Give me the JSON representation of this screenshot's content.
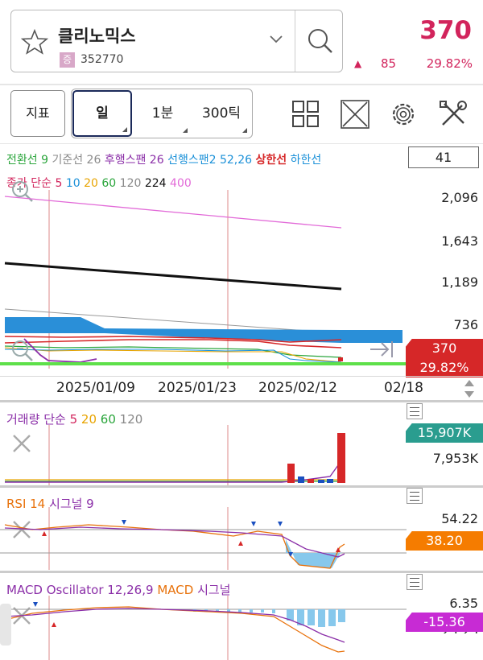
{
  "stock": {
    "name": "클리노믹스",
    "market_badge": "증",
    "code": "352770"
  },
  "quote": {
    "price": "370",
    "change_arrow": "▲",
    "change": "85",
    "change_pct": "29.82%"
  },
  "toolbar": {
    "indicator_label": "지표",
    "period_day": "일",
    "period_min": "1분",
    "period_tick": "300틱"
  },
  "price_panel": {
    "ichimoku_items": [
      {
        "text": "전환선 9",
        "color": "#2aa53b"
      },
      {
        "text": "기준선 26",
        "color": "#8a8a8a"
      },
      {
        "text": "후행스팬 26",
        "color": "#8b2fa8"
      },
      {
        "text": "선행스팬2 52,26",
        "color": "#1a90d8"
      },
      {
        "text": "상한선",
        "color": "#d62728"
      },
      {
        "text": "하한선",
        "color": "#1a90d8"
      }
    ],
    "ma_items": [
      {
        "text": "종가",
        "color": "#d2245c"
      },
      {
        "text": "단순",
        "color": "#d2245c"
      },
      {
        "text": "5",
        "color": "#d2245c"
      },
      {
        "text": "10",
        "color": "#1a90d8"
      },
      {
        "text": "20",
        "color": "#e8a400"
      },
      {
        "text": "60",
        "color": "#2aa53b"
      },
      {
        "text": "120",
        "color": "#888888"
      },
      {
        "text": "224",
        "color": "#111111"
      },
      {
        "text": "400",
        "color": "#e26ad8"
      }
    ],
    "count_box": "41",
    "y_ticks": [
      "2,096",
      "1,643",
      "1,189",
      "736"
    ],
    "price_tag": "370",
    "pct_tag": "29.82%"
  },
  "x_axis": {
    "labels": [
      "2025/01/09",
      "2025/01/23",
      "2025/02/12",
      "02/18"
    ]
  },
  "volume_panel": {
    "header": [
      {
        "text": "거래량",
        "color": "#8b2fa8"
      },
      {
        "text": "단순",
        "color": "#8b2fa8"
      },
      {
        "text": "5",
        "color": "#d2245c"
      },
      {
        "text": "20",
        "color": "#e8a400"
      },
      {
        "text": "60",
        "color": "#2aa53b"
      },
      {
        "text": "120",
        "color": "#888888"
      }
    ],
    "tag": "15,907K",
    "mid_tick": "7,953K"
  },
  "rsi_panel": {
    "header": [
      {
        "text": "RSI 14",
        "color": "#e8720c"
      },
      {
        "text": "시그널 9",
        "color": "#8b2fa8"
      }
    ],
    "tick": "54.22",
    "tag": "38.20"
  },
  "macd_panel": {
    "header": [
      {
        "text": "MACD Oscillator 12,26,9",
        "color": "#8b2fa8"
      },
      {
        "text": "MACD",
        "color": "#e8720c"
      },
      {
        "text": "시그널",
        "color": "#8b2fa8"
      }
    ],
    "tick": "6.35",
    "tick2": "25.25",
    "tag": "-15.36"
  },
  "colors": {
    "up": "#d2245c",
    "volume_tag": "#2a9d8f",
    "rsi_tag": "#f57c00",
    "macd_tag": "#c72bd4",
    "price_tag": "#d62728"
  }
}
